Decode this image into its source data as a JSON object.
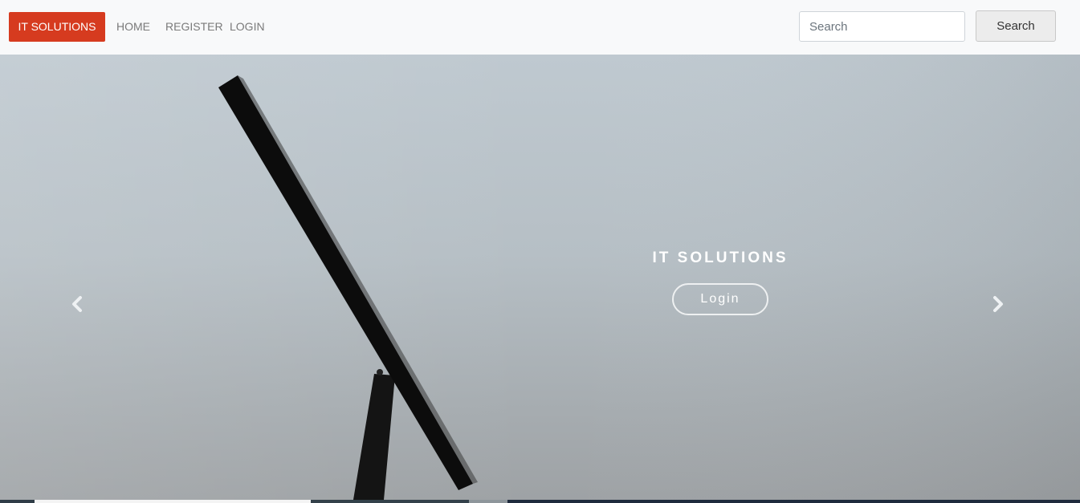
{
  "navbar": {
    "brand": "IT SOLUTIONS",
    "links": [
      "HOME",
      "REGISTER",
      "LOGIN"
    ],
    "search": {
      "placeholder": "Search",
      "value": "",
      "button_label": "Search"
    }
  },
  "hero": {
    "title": "IT SOLUTIONS",
    "login_label": "Login",
    "prev_icon": "chevron-left-icon",
    "next_icon": "chevron-right-icon"
  },
  "colors": {
    "brand": "#d63b1f",
    "nav_background": "#f8f9fa",
    "hero_background": "#b6bfc5"
  }
}
